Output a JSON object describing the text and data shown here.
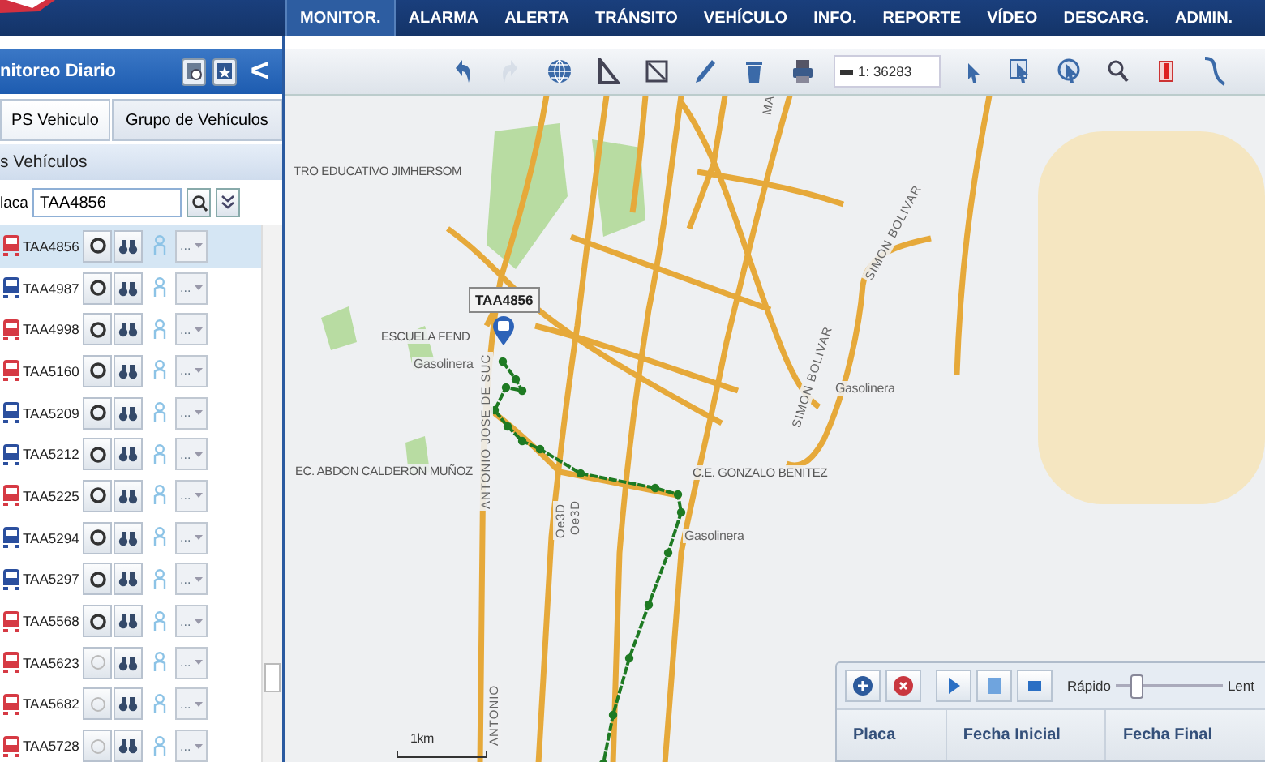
{
  "nav": {
    "items": [
      {
        "label": "MONITOR.",
        "selected": true
      },
      {
        "label": "ALARMA",
        "selected": false
      },
      {
        "label": "ALERTA",
        "selected": false
      },
      {
        "label": "TRÁNSITO",
        "selected": false
      },
      {
        "label": "VEHÍCULO",
        "selected": false
      },
      {
        "label": "INFO.",
        "selected": false
      },
      {
        "label": "REPORTE",
        "selected": false
      },
      {
        "label": "VÍDEO",
        "selected": false
      },
      {
        "label": "DESCARG.",
        "selected": false
      },
      {
        "label": "ADMIN.",
        "selected": false
      }
    ]
  },
  "sidebar": {
    "title": "nitoreo Diario",
    "collapse": "<",
    "tabs": [
      {
        "label": "PS Vehiculo",
        "selected": true
      },
      {
        "label": "Grupo de Vehículos",
        "selected": false
      }
    ],
    "section": "s Vehículos",
    "search": {
      "label": "laca",
      "value": "TAA4856"
    },
    "vehicles": [
      {
        "plate": "TAA4856",
        "color": "#d63a44",
        "selected": true,
        "locate_enabled": true,
        "menu": "..."
      },
      {
        "plate": "TAA4987",
        "color": "#2b4f9e",
        "selected": false,
        "locate_enabled": true,
        "menu": "..."
      },
      {
        "plate": "TAA4998",
        "color": "#d63a44",
        "selected": false,
        "locate_enabled": true,
        "menu": "..."
      },
      {
        "plate": "TAA5160",
        "color": "#d63a44",
        "selected": false,
        "locate_enabled": true,
        "menu": "..."
      },
      {
        "plate": "TAA5209",
        "color": "#2b4f9e",
        "selected": false,
        "locate_enabled": true,
        "menu": "..."
      },
      {
        "plate": "TAA5212",
        "color": "#2b4f9e",
        "selected": false,
        "locate_enabled": true,
        "menu": "..."
      },
      {
        "plate": "TAA5225",
        "color": "#d63a44",
        "selected": false,
        "locate_enabled": true,
        "menu": "..."
      },
      {
        "plate": "TAA5294",
        "color": "#2b4f9e",
        "selected": false,
        "locate_enabled": true,
        "menu": "..."
      },
      {
        "plate": "TAA5297",
        "color": "#2b4f9e",
        "selected": false,
        "locate_enabled": true,
        "menu": "..."
      },
      {
        "plate": "TAA5568",
        "color": "#d63a44",
        "selected": false,
        "locate_enabled": true,
        "menu": "..."
      },
      {
        "plate": "TAA5623",
        "color": "#d63a44",
        "selected": false,
        "locate_enabled": false,
        "menu": "..."
      },
      {
        "plate": "TAA5682",
        "color": "#d63a44",
        "selected": false,
        "locate_enabled": false,
        "menu": "..."
      },
      {
        "plate": "TAA5728",
        "color": "#d63a44",
        "selected": false,
        "locate_enabled": false,
        "menu": "..."
      }
    ]
  },
  "toolbar": {
    "tools": [
      {
        "kind": "undo",
        "disabled": false
      },
      {
        "kind": "redo",
        "disabled": true
      },
      {
        "kind": "globe",
        "disabled": false
      },
      {
        "kind": "ruler",
        "disabled": false
      },
      {
        "kind": "area",
        "disabled": false
      },
      {
        "kind": "pencil",
        "disabled": false
      },
      {
        "kind": "trash",
        "disabled": false
      },
      {
        "kind": "printer",
        "disabled": false
      },
      {
        "kind": "scale",
        "disabled": false
      },
      {
        "kind": "pointer",
        "disabled": false
      },
      {
        "kind": "select",
        "disabled": false
      },
      {
        "kind": "circle",
        "disabled": false
      },
      {
        "kind": "search",
        "disabled": false
      },
      {
        "kind": "bookmark",
        "disabled": false
      },
      {
        "kind": "curve",
        "disabled": false
      }
    ],
    "scale": "1: 36283"
  },
  "map": {
    "labels": [
      {
        "kind": "place",
        "text": "TRO EDUCATIVO JIMHERSOM"
      },
      {
        "kind": "place",
        "text": "ESCUELA FEND"
      },
      {
        "kind": "poi",
        "text": "Gasolinera"
      },
      {
        "kind": "place",
        "text": "EC. ABDON CALDERON MUÑOZ"
      },
      {
        "kind": "place",
        "text": "C.E. GONZALO BENITEZ"
      },
      {
        "kind": "poi",
        "text": "Gasolinera"
      },
      {
        "kind": "poi",
        "text": "Gasolinera"
      },
      {
        "kind": "street",
        "text": "ANTONIO JOSE DE SUC"
      },
      {
        "kind": "street",
        "text": "ANTONIO"
      },
      {
        "kind": "street",
        "text": "SIMON BOLIVAR"
      },
      {
        "kind": "street",
        "text": "SIMON BOLIVAR"
      },
      {
        "kind": "street",
        "text": "Oe3D"
      },
      {
        "kind": "street",
        "text": "Oe3D"
      },
      {
        "kind": "street",
        "text": "MA"
      },
      {
        "kind": "scale",
        "text": "1km"
      }
    ],
    "marker": {
      "plate": "TAA4856"
    }
  },
  "playback": {
    "speed_fast": "Rápido",
    "speed_slow": "Lent",
    "speed": {
      "level": 0.15
    },
    "columns": [
      "Placa",
      "Fecha Inicial",
      "Fecha Final"
    ]
  }
}
